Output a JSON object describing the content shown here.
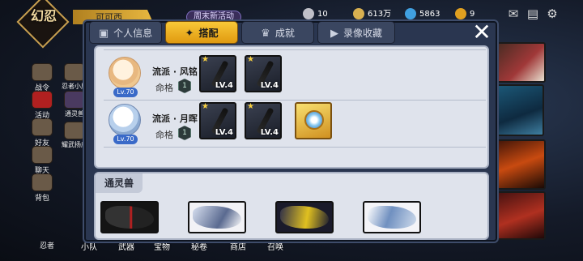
{
  "topbar": {
    "logo_text": "幻忍",
    "player_name": "可可西",
    "event_tag": "周末新活动",
    "resources": [
      {
        "name": "silver-coin",
        "value": "10"
      },
      {
        "name": "gold-coin",
        "value": "613万"
      },
      {
        "name": "gem",
        "value": "5863"
      },
      {
        "name": "stamina",
        "value": "9"
      }
    ]
  },
  "sidebar": {
    "items": [
      {
        "label": "战令"
      },
      {
        "label": "活动"
      },
      {
        "label": "好友"
      },
      {
        "label": "聊天"
      },
      {
        "label": "背包"
      }
    ],
    "items_col2": [
      {
        "label": "忍者小屋"
      },
      {
        "label": "通灵兽"
      },
      {
        "label": "耀武扬威"
      }
    ],
    "bottom_left": "忍者"
  },
  "bottom_nav": [
    "小队",
    "武器",
    "宝物",
    "秘卷",
    "商店",
    "召唤"
  ],
  "modal": {
    "tabs": [
      {
        "label": "个人信息",
        "icon": "card-icon",
        "active": false
      },
      {
        "label": "搭配",
        "icon": "shuriken-icon",
        "active": true
      },
      {
        "label": "成就",
        "icon": "trophy-icon",
        "active": false
      },
      {
        "label": "录像收藏",
        "icon": "play-icon",
        "active": false
      }
    ],
    "close_glyph": "✕",
    "rows": [
      {
        "hero_name": "流派 · 风铭",
        "level": "Lv.70",
        "fate_label": "命格",
        "fate_value": "1",
        "slots": [
          {
            "type": "weapon",
            "level": "LV.4",
            "stars": "★"
          },
          {
            "type": "weapon",
            "level": "LV.4",
            "stars": "★"
          }
        ]
      },
      {
        "hero_name": "流派 · 月晖",
        "level": "Lv.70",
        "fate_label": "命格",
        "fate_value": "1",
        "slots": [
          {
            "type": "weapon",
            "level": "LV.4",
            "stars": "★"
          },
          {
            "type": "weapon",
            "level": "LV.4",
            "stars": "★"
          },
          {
            "type": "treasure",
            "level": "",
            "stars": ""
          }
        ]
      }
    ],
    "beast_section": {
      "title": "通灵兽",
      "beasts": [
        {
          "name": "black-wolf"
        },
        {
          "name": "white-eagle"
        },
        {
          "name": "dark-dragon"
        },
        {
          "name": "white-tiger"
        }
      ]
    }
  }
}
